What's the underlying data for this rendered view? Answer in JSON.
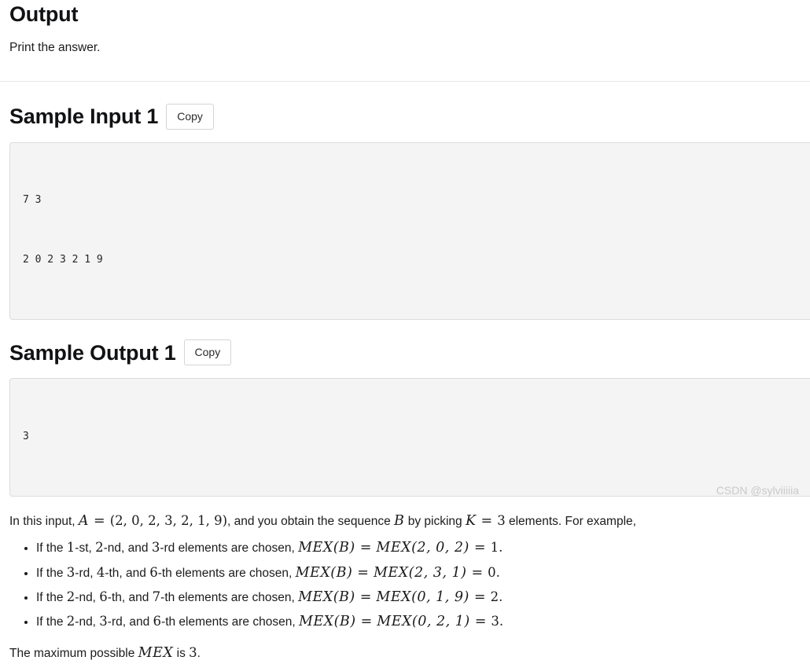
{
  "output_section": {
    "heading": "Output",
    "body": "Print the answer."
  },
  "sample_input": {
    "heading": "Sample Input 1",
    "copy_label": "Copy",
    "lines": [
      "7 3",
      "2 0 2 3 2 1 9"
    ]
  },
  "sample_output": {
    "heading": "Sample Output 1",
    "copy_label": "Copy",
    "lines": [
      "3"
    ]
  },
  "explanation": {
    "intro": {
      "t1": "In this input, ",
      "A": "A",
      "eq1": "=",
      "seq": "(2, 0, 2, 3, 2, 1, 9)",
      "t2": ", and you obtain the sequence ",
      "B": "B",
      "t3": " by picking ",
      "K": "K",
      "eq2": "=",
      "Kval": "3",
      "t4": " elements. For example,"
    },
    "bullets": [
      {
        "lead": "If the ",
        "o1": "1",
        "s1": "-st, ",
        "o2": "2",
        "s2": "-nd, and ",
        "o3": "3",
        "s3": "-rd elements are chosen, ",
        "mexB": "MEX(B)",
        "eq": "=",
        "mexVals": "MEX(2, 0, 2)",
        "eq2": "=",
        "result": "1",
        "period": "."
      },
      {
        "lead": "If the ",
        "o1": "3",
        "s1": "-rd, ",
        "o2": "4",
        "s2": "-th, and ",
        "o3": "6",
        "s3": "-th elements are chosen, ",
        "mexB": "MEX(B)",
        "eq": "=",
        "mexVals": "MEX(2, 3, 1)",
        "eq2": "=",
        "result": "0",
        "period": "."
      },
      {
        "lead": "If the ",
        "o1": "2",
        "s1": "-nd, ",
        "o2": "6",
        "s2": "-th, and ",
        "o3": "7",
        "s3": "-th elements are chosen, ",
        "mexB": "MEX(B)",
        "eq": "=",
        "mexVals": "MEX(0, 1, 9)",
        "eq2": "=",
        "result": "2",
        "period": "."
      },
      {
        "lead": "If the ",
        "o1": "2",
        "s1": "-nd, ",
        "o2": "3",
        "s2": "-rd, and ",
        "o3": "6",
        "s3": "-th elements are chosen, ",
        "mexB": "MEX(B)",
        "eq": "=",
        "mexVals": "MEX(0, 2, 1)",
        "eq2": "=",
        "result": "3",
        "period": "."
      }
    ],
    "conclusion": {
      "t1": "The maximum possible ",
      "mex": "MEX",
      "t2": " is ",
      "value": "3",
      "period": "."
    }
  },
  "watermark": "CSDN @sylviiiiia"
}
